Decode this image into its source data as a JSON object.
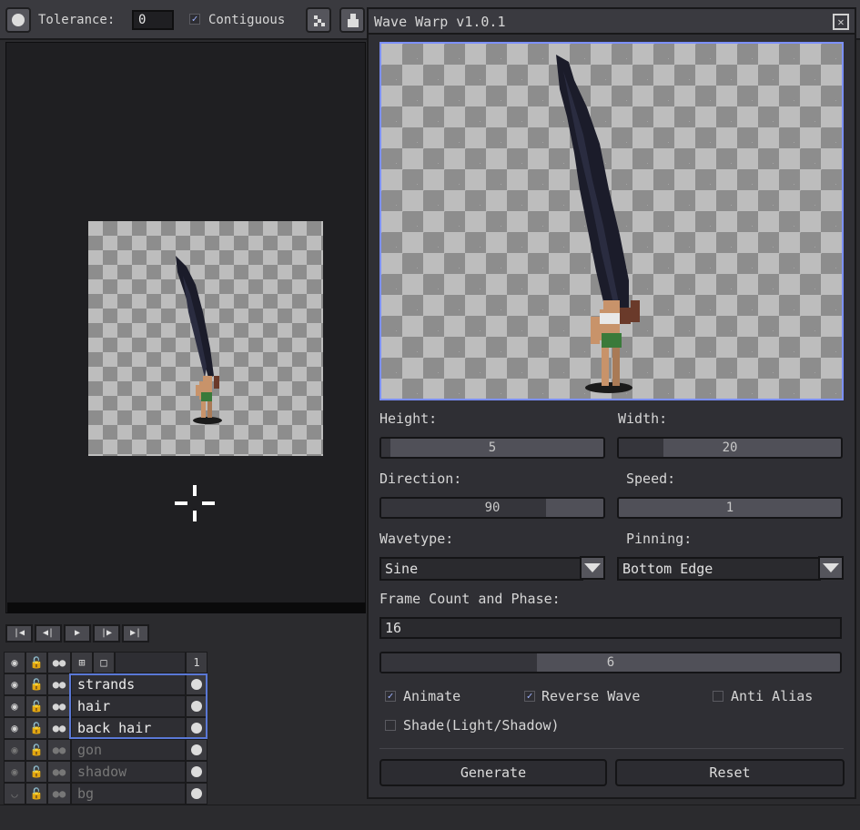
{
  "toolbar": {
    "tolerance_label": "Tolerance:",
    "tolerance_value": "0",
    "contiguous_label": "Contiguous",
    "contiguous_checked": true
  },
  "timeline": {
    "frame_number": "1"
  },
  "layers": [
    {
      "name": "strands",
      "visible": true,
      "selected": true
    },
    {
      "name": "hair",
      "visible": true,
      "selected": true
    },
    {
      "name": "back hair",
      "visible": true,
      "selected": true
    },
    {
      "name": "gon",
      "visible": true,
      "selected": false
    },
    {
      "name": "shadow",
      "visible": true,
      "selected": false
    },
    {
      "name": "bg",
      "visible": false,
      "selected": false
    }
  ],
  "dialog": {
    "title": "Wave Warp v1.0.1",
    "height_label": "Height:",
    "height_value": "5",
    "height_fraction": 0.04,
    "width_label": "Width:",
    "width_value": "20",
    "width_fraction": 0.2,
    "direction_label": "Direction:",
    "direction_value": "90",
    "direction_fraction": 0.74,
    "speed_label": "Speed:",
    "speed_value": "1",
    "speed_fraction": 0.0,
    "wavetype_label": "Wavetype:",
    "wavetype_value": "Sine",
    "pinning_label": "Pinning:",
    "pinning_value": "Bottom Edge",
    "frame_label": "Frame Count and Phase:",
    "frame_count": "16",
    "phase_value": "6",
    "phase_fraction": 0.34,
    "animate_label": "Animate",
    "animate_checked": true,
    "reverse_label": "Reverse Wave",
    "reverse_checked": true,
    "antialias_label": "Anti Alias",
    "antialias_checked": false,
    "shade_label": "Shade(Light/Shadow)",
    "shade_checked": false,
    "generate_label": "Generate",
    "reset_label": "Reset"
  },
  "colors": {
    "accent": "#7c90ff",
    "hair": "#1b1c2a",
    "skin": "#c8936a",
    "shorts": "#3a7a3a"
  }
}
